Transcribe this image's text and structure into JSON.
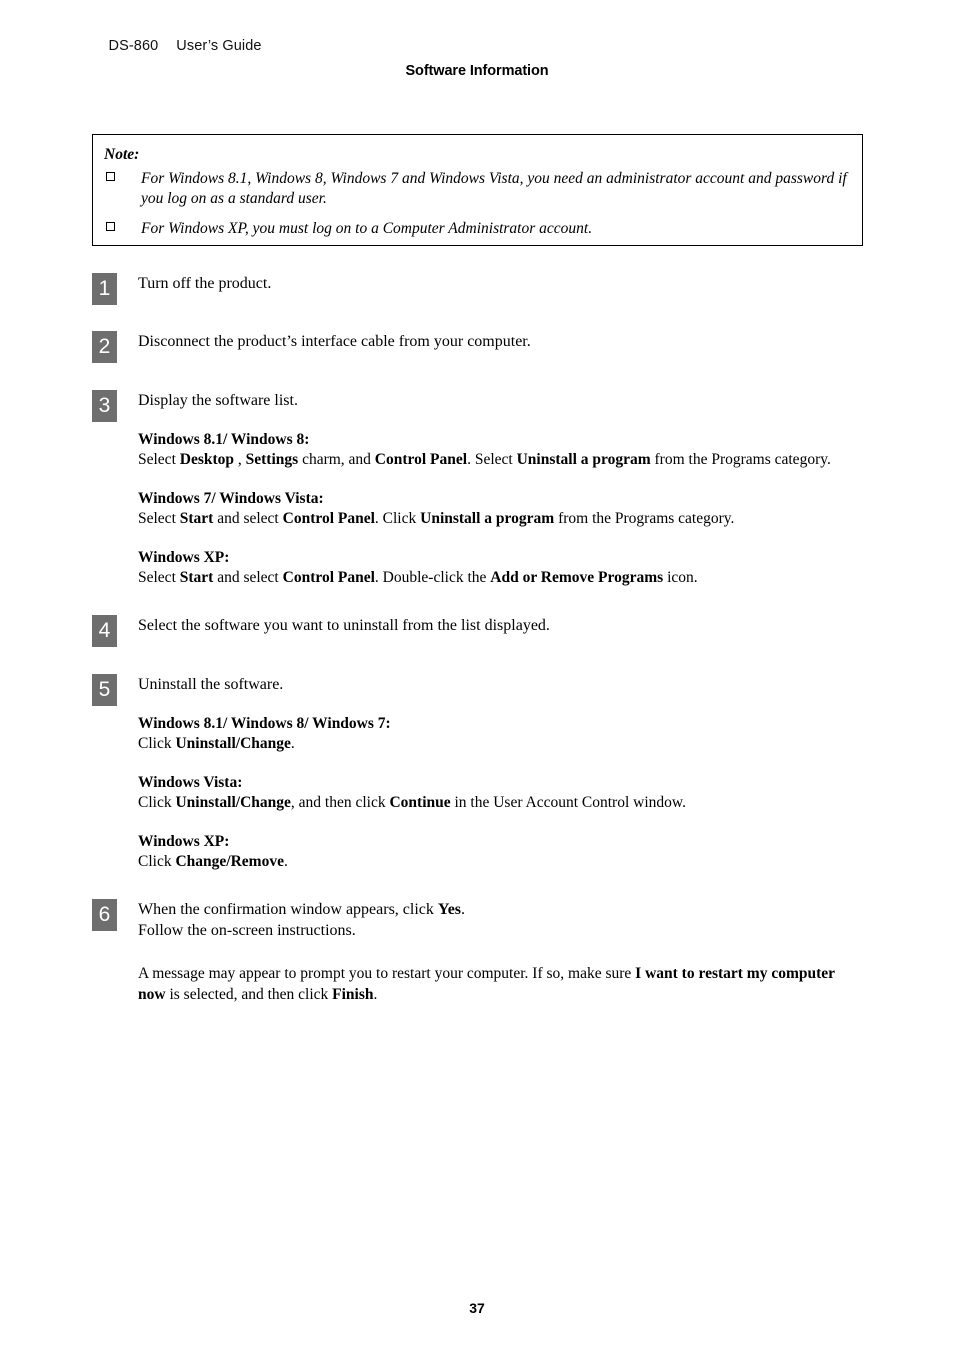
{
  "header": {
    "model": "DS-860",
    "guide": "User’s Guide",
    "chapter_title": "Software Information"
  },
  "note": {
    "label": "Note:",
    "bullet_icon": "hollow-square-bullet",
    "items": [
      "For Windows 8.1, Windows 8, Windows 7 and Windows Vista, you need an administrator account and password if you log on as a standard user.",
      "For Windows XP, you must log on to a Computer Administrator account."
    ]
  },
  "steps": [
    {
      "number": "1",
      "lead": "Turn off the product."
    },
    {
      "number": "2",
      "lead": "Disconnect the product’s interface cable from your computer."
    },
    {
      "number": "3",
      "lead": "Display the software list.",
      "blocks": [
        {
          "heading": "Windows 8.1/ Windows 8:",
          "segments": [
            {
              "text": "Select ",
              "bold": false
            },
            {
              "text": "Desktop",
              "bold": true
            },
            {
              "text": " , ",
              "bold": false
            },
            {
              "text": "Settings",
              "bold": true
            },
            {
              "text": " charm, and ",
              "bold": false
            },
            {
              "text": "Control Panel",
              "bold": true
            },
            {
              "text": ". Select ",
              "bold": false
            },
            {
              "text": "Uninstall a program",
              "bold": true
            },
            {
              "text": " from the Programs category.",
              "bold": false
            }
          ]
        },
        {
          "heading": "Windows 7/ Windows Vista:",
          "segments": [
            {
              "text": "Select ",
              "bold": false
            },
            {
              "text": "Start",
              "bold": true
            },
            {
              "text": " and select ",
              "bold": false
            },
            {
              "text": "Control Panel",
              "bold": true
            },
            {
              "text": ". Click ",
              "bold": false
            },
            {
              "text": "Uninstall a program",
              "bold": true
            },
            {
              "text": " from the Programs category.",
              "bold": false
            }
          ]
        },
        {
          "heading": "Windows XP:",
          "segments": [
            {
              "text": "Select ",
              "bold": false
            },
            {
              "text": "Start",
              "bold": true
            },
            {
              "text": " and select ",
              "bold": false
            },
            {
              "text": "Control Panel",
              "bold": true
            },
            {
              "text": ". Double-click the ",
              "bold": false
            },
            {
              "text": "Add or Remove Programs",
              "bold": true
            },
            {
              "text": " icon.",
              "bold": false
            }
          ]
        }
      ]
    },
    {
      "number": "4",
      "lead": "Select the software you want to uninstall from the list displayed."
    },
    {
      "number": "5",
      "lead": "Uninstall the software.",
      "blocks": [
        {
          "heading": "Windows 8.1/ Windows 8/ Windows 7:",
          "segments": [
            {
              "text": "Click ",
              "bold": false
            },
            {
              "text": "Uninstall/Change",
              "bold": true
            },
            {
              "text": ".",
              "bold": false
            }
          ]
        },
        {
          "heading": "Windows Vista:",
          "segments": [
            {
              "text": "Click ",
              "bold": false
            },
            {
              "text": "Uninstall/Change",
              "bold": true
            },
            {
              "text": ", and then click ",
              "bold": false
            },
            {
              "text": "Continue",
              "bold": true
            },
            {
              "text": " in the User Account Control window.",
              "bold": false
            }
          ]
        },
        {
          "heading": "Windows XP:",
          "segments": [
            {
              "text": "Click ",
              "bold": false
            },
            {
              "text": "Change/Remove",
              "bold": true
            },
            {
              "text": ".",
              "bold": false
            }
          ]
        }
      ]
    },
    {
      "number": "6",
      "lead_segments": [
        {
          "text": "When the confirmation window appears, click ",
          "bold": false
        },
        {
          "text": "Yes",
          "bold": true
        },
        {
          "text": ".\nFollow the on-screen instructions.",
          "bold": false
        }
      ],
      "paragraph_segments": [
        {
          "text": "A message may appear to prompt you to restart your computer. If so, make sure ",
          "bold": false
        },
        {
          "text": "I want to restart my computer now",
          "bold": true
        },
        {
          "text": " is selected, and then click ",
          "bold": false
        },
        {
          "text": "Finish",
          "bold": true
        },
        {
          "text": ".",
          "bold": false
        }
      ]
    }
  ],
  "footer": {
    "page_number": "37"
  },
  "colors": {
    "step_box": "#6e6e6e",
    "step_number_text": "#ffffff",
    "text": "#000000",
    "note_border": "#000000",
    "page_background": "#ffffff"
  }
}
